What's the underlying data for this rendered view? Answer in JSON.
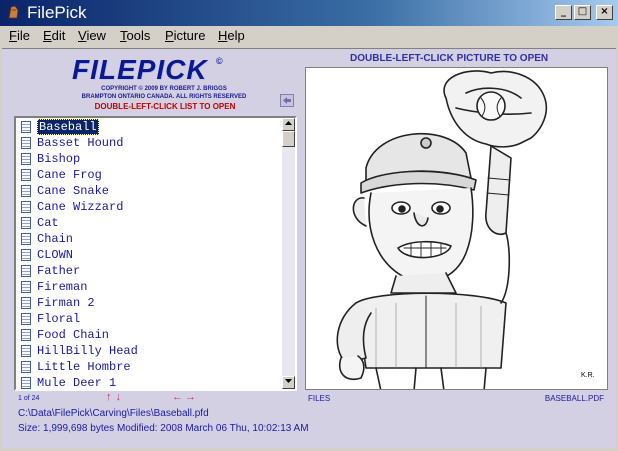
{
  "window": {
    "title": "FilePick",
    "minimize": "_",
    "maximize": "□",
    "close": "×"
  },
  "menu": [
    {
      "u": "F",
      "rest": "ile"
    },
    {
      "u": "E",
      "rest": "dit"
    },
    {
      "u": "V",
      "rest": "iew"
    },
    {
      "u": "T",
      "rest": "ools"
    },
    {
      "u": "P",
      "rest": "icture"
    },
    {
      "u": "H",
      "rest": "elp"
    }
  ],
  "logo": {
    "text": "FILEPICK",
    "mark": "©"
  },
  "copyright": {
    "line1": "COPYRIGHT © 2009 BY ROBERT J. BRIGGS",
    "line2": "BRAMPTON ONTARIO CANADA. ALL RIGHTS RESERVED"
  },
  "instructions": {
    "list": "DOUBLE-LEFT-CLICK LIST TO OPEN",
    "picture": "DOUBLE-LEFT-CLICK PICTURE TO OPEN"
  },
  "back_icon": "arrow-left-icon",
  "files": [
    "Baseball",
    "Basset Hound",
    "Bishop",
    "Cane Frog",
    "Cane Snake",
    "Cane Wizzard",
    "Cat",
    "Chain",
    "CLOWN",
    "Father",
    "Fireman",
    "Firman 2",
    "Floral",
    "Food Chain",
    "HillBilly Head",
    "Little Hombre",
    "Mule Deer 1"
  ],
  "selected_index": 0,
  "picture": {
    "artist_initials": "K.R."
  },
  "footer": {
    "count": "1 of 24",
    "updown": "↑↓",
    "leftright": "←→",
    "files_label": "FILES",
    "filename": "BASEBALL.PDF",
    "path": "C:\\Data\\FilePick\\Carving\\Files\\Baseball.pfd",
    "size_info": "Size: 1,999,698 bytes   Modified: 2008 March 06 Thu, 10:02:13 AM"
  },
  "colors": {
    "titlebar": "#0a246a",
    "client_bg": "#d4d0e4",
    "text_blue": "#1a1aa0",
    "logo_blue": "#0a1a8c",
    "instruction_red": "#c00000"
  }
}
